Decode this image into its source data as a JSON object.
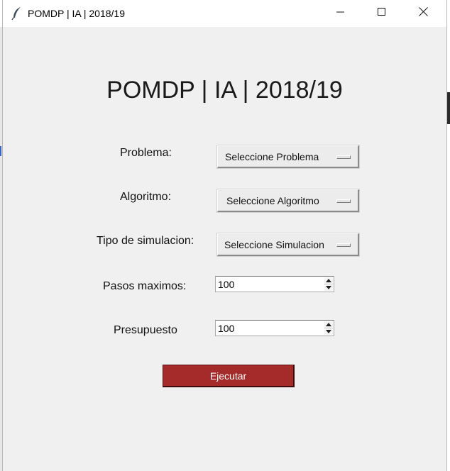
{
  "window": {
    "title": "POMDP | IA | 2018/19"
  },
  "heading": "POMDP | IA | 2018/19",
  "form": {
    "problema": {
      "label": "Problema:",
      "selected": "Seleccione Problema"
    },
    "algoritmo": {
      "label": "Algoritmo:",
      "selected": "Seleccione Algoritmo"
    },
    "simulacion": {
      "label": "Tipo de simulacion:",
      "selected": "Seleccione Simulacion"
    },
    "pasos": {
      "label": "Pasos maximos:",
      "value": "100"
    },
    "presupuesto": {
      "label": "Presupuesto",
      "value": "100"
    }
  },
  "run_button": {
    "label": "Ejecutar",
    "color": "#a52a2a"
  },
  "icons": {
    "app": "feather-icon",
    "minimize": "minimize-icon",
    "maximize": "maximize-icon",
    "close": "close-icon"
  }
}
